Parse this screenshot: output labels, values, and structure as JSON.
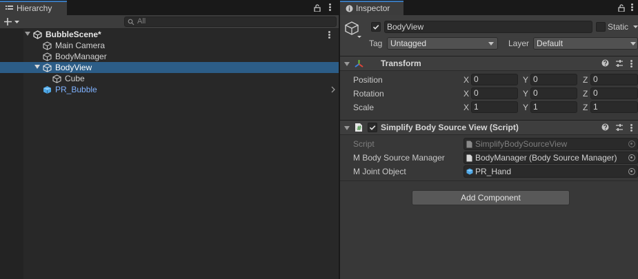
{
  "hierarchy": {
    "tab_title": "Hierarchy",
    "search_placeholder": "All",
    "scene": "BubbleScene*",
    "items": [
      {
        "label": "Main Camera"
      },
      {
        "label": "BodyManager"
      },
      {
        "label": "BodyView"
      },
      {
        "label": "Cube"
      },
      {
        "label": "PR_Bubble"
      }
    ]
  },
  "inspector": {
    "tab_title": "Inspector",
    "object_name": "BodyView",
    "static_label": "Static",
    "tag_label": "Tag",
    "tag_value": "Untagged",
    "layer_label": "Layer",
    "layer_value": "Default",
    "transform": {
      "title": "Transform",
      "rows": [
        {
          "label": "Position",
          "x": "0",
          "y": "0",
          "z": "0"
        },
        {
          "label": "Rotation",
          "x": "0",
          "y": "0",
          "z": "0"
        },
        {
          "label": "Scale",
          "x": "1",
          "y": "1",
          "z": "1"
        }
      ],
      "axis": {
        "x": "X",
        "y": "Y",
        "z": "Z"
      }
    },
    "script_component": {
      "title": "Simplify Body Source View (Script)",
      "script_label": "Script",
      "script_value": "SimplifyBodySourceView",
      "manager_label": "M Body Source Manager",
      "manager_value": "BodyManager (Body Source Manager)",
      "joint_label": "M Joint Object",
      "joint_value": "PR_Hand"
    },
    "add_component": "Add Component"
  },
  "colors": {
    "selection": "#2c5d87",
    "prefab_text": "#7fb2ff",
    "tab_accent": "#3a79bb"
  }
}
